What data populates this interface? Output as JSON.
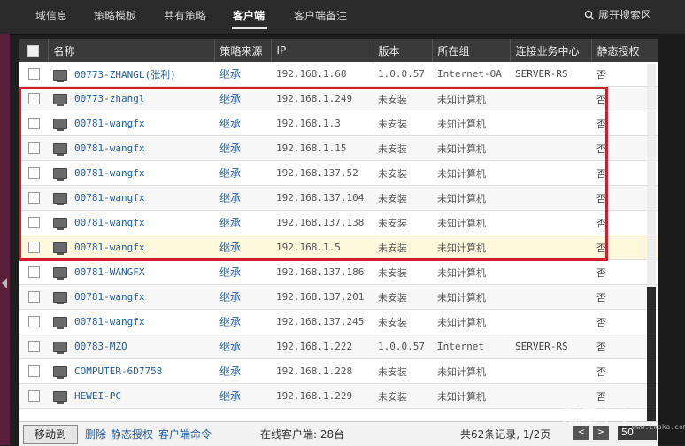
{
  "top_tabs": [
    {
      "label": "域信息"
    },
    {
      "label": "策略模板"
    },
    {
      "label": "共有策略"
    },
    {
      "label": "客户端"
    },
    {
      "label": "客户端备注"
    }
  ],
  "search_toggle": {
    "label": "展开搜索区",
    "icon": "search-icon"
  },
  "table": {
    "headers": [
      "名称",
      "策略来源",
      "IP",
      "版本",
      "所在组",
      "连接业务中心",
      "静态授权"
    ],
    "rows": [
      {
        "name": "00773-ZHANGL(张利)",
        "source": "继承",
        "ip": "192.168.1.68",
        "version": "1.0.0.57",
        "group": "Internet-OA",
        "server": "SERVER-RS",
        "auth": "否"
      },
      {
        "name": "00773-zhangl",
        "source": "继承",
        "ip": "192.168.1.249",
        "version": "未安装",
        "group": "未知计算机",
        "server": "",
        "auth": "否"
      },
      {
        "name": "00781-wangfx",
        "source": "继承",
        "ip": "192.168.1.3",
        "version": "未安装",
        "group": "未知计算机",
        "server": "",
        "auth": "否"
      },
      {
        "name": "00781-wangfx",
        "source": "继承",
        "ip": "192.168.1.15",
        "version": "未安装",
        "group": "未知计算机",
        "server": "",
        "auth": "否"
      },
      {
        "name": "00781-wangfx",
        "source": "继承",
        "ip": "192.168.137.52",
        "version": "未安装",
        "group": "未知计算机",
        "server": "",
        "auth": "否"
      },
      {
        "name": "00781-wangfx",
        "source": "继承",
        "ip": "192.168.137.104",
        "version": "未安装",
        "group": "未知计算机",
        "server": "",
        "auth": "否"
      },
      {
        "name": "00781-wangfx",
        "source": "继承",
        "ip": "192.168.137.138",
        "version": "未安装",
        "group": "未知计算机",
        "server": "",
        "auth": "否"
      },
      {
        "name": "00781-wangfx",
        "source": "继承",
        "ip": "192.168.1.5",
        "version": "未安装",
        "group": "未知计算机",
        "server": "",
        "auth": "否"
      },
      {
        "name": "00781-WANGFX",
        "source": "继承",
        "ip": "192.168.137.186",
        "version": "未安装",
        "group": "未知计算机",
        "server": "",
        "auth": "否"
      },
      {
        "name": "00781-wangfx",
        "source": "继承",
        "ip": "192.168.137.201",
        "version": "未安装",
        "group": "未知计算机",
        "server": "",
        "auth": "否"
      },
      {
        "name": "00781-wangfx",
        "source": "继承",
        "ip": "192.168.137.245",
        "version": "未安装",
        "group": "未知计算机",
        "server": "",
        "auth": "否"
      },
      {
        "name": "00783-MZQ",
        "source": "继承",
        "ip": "192.168.1.222",
        "version": "1.0.0.57",
        "group": "Internet",
        "server": "SERVER-RS",
        "auth": "否"
      },
      {
        "name": "COMPUTER-6D7758",
        "source": "继承",
        "ip": "192.168.1.228",
        "version": "未安装",
        "group": "未知计算机",
        "server": "",
        "auth": "否"
      },
      {
        "name": "HEWEI-PC",
        "source": "继承",
        "ip": "192.168.1.229",
        "version": "未安装",
        "group": "未知计算机",
        "server": "",
        "auth": "否"
      }
    ]
  },
  "footer": {
    "move_label": "移动到",
    "delete_label": "删除",
    "static_auth_label": "静态授权",
    "client_cmd_label": "客户端命令",
    "online_label": "在线客户端: 28台",
    "records_label": "共62条记录, 1/2页",
    "prev": "<",
    "next": ">",
    "page_size": "50"
  },
  "watermark": {
    "text": "瑞星卡卡",
    "url": "www.ikaka.com"
  },
  "colors": {
    "highlight_border": "#d41c2a",
    "link": "#1f5fa8",
    "header_bg": "#3a3a3a",
    "topbar_bg": "#2a2a2a"
  }
}
